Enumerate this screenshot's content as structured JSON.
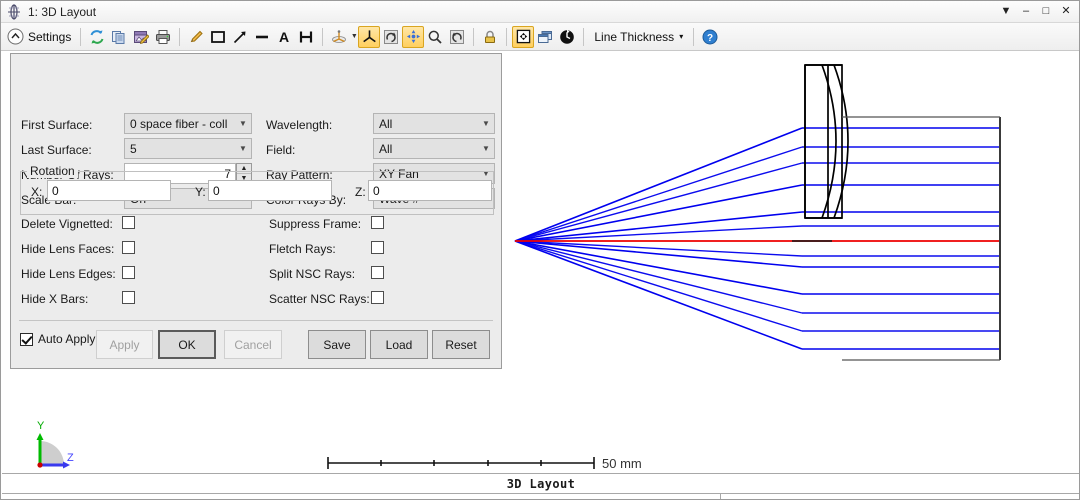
{
  "window": {
    "title": "1: 3D Layout",
    "icon": "layout-3d-icon",
    "controls": {
      "dropdown": "▼",
      "minimize": "–",
      "maximize": "□",
      "close": "✕"
    }
  },
  "toolbar": {
    "settings_label": "Settings",
    "line_thickness_label": "Line Thickness",
    "line_thickness_caret": "▾",
    "icons": [
      "refresh-icon",
      "copy-icon",
      "save-image-icon",
      "print-icon",
      "pencil-icon",
      "rectangle-icon",
      "arrow-icon",
      "line-icon",
      "text-icon",
      "measure-icon",
      "orientation-icon",
      "orientation-caret-icon",
      "isometric-view-icon",
      "rotate-icon",
      "pan-icon",
      "zoom-icon",
      "undo-zoom-icon",
      "lock-icon",
      "fit-window-icon",
      "window-clone-icon",
      "refresh-clock-icon",
      "help-icon"
    ]
  },
  "settings": {
    "left_column": [
      {
        "label": "First Surface:",
        "value": "0 space fiber - coll",
        "type": "combo"
      },
      {
        "label": "Last Surface:",
        "value": "5",
        "type": "combo"
      },
      {
        "label": "Number Of Rays:",
        "value": "7",
        "type": "spinner"
      },
      {
        "label": "Scale Bar:",
        "value": "On",
        "type": "combo"
      }
    ],
    "right_column": [
      {
        "label": "Wavelength:",
        "value": "All",
        "type": "combo"
      },
      {
        "label": "Field:",
        "value": "All",
        "type": "combo"
      },
      {
        "label": "Ray Pattern:",
        "value": "XY Fan",
        "type": "combo"
      },
      {
        "label": "Color Rays By:",
        "value": "Wave #",
        "type": "combo"
      }
    ],
    "rotation": {
      "group_title": "Rotation",
      "x_label": "X:",
      "x_value": "0",
      "y_label": "Y:",
      "y_value": "0",
      "z_label": "Z:",
      "z_value": "0"
    },
    "checkboxes_left": [
      {
        "label": "Delete Vignetted:",
        "checked": false
      },
      {
        "label": "Hide Lens Faces:",
        "checked": false
      },
      {
        "label": "Hide Lens Edges:",
        "checked": false
      },
      {
        "label": "Hide X Bars:",
        "checked": false
      }
    ],
    "checkboxes_right": [
      {
        "label": "Suppress Frame:",
        "checked": false
      },
      {
        "label": "Fletch Rays:",
        "checked": false
      },
      {
        "label": "Split NSC Rays:",
        "checked": false
      },
      {
        "label": "Scatter NSC Rays:",
        "checked": false
      }
    ],
    "auto_apply_label": "Auto Apply",
    "auto_apply_checked": true,
    "buttons": {
      "apply": "Apply",
      "ok": "OK",
      "cancel": "Cancel",
      "save": "Save",
      "load": "Load",
      "reset": "Reset"
    }
  },
  "graphics": {
    "scale_bar_label": "50 mm",
    "axis_y_label": "Y",
    "axis_z_label": "Z",
    "caption": "3D  Layout",
    "colors": {
      "ray_blue": "#0000ee",
      "ray_red": "#ee0000",
      "element_outline": "#000000",
      "axis_y": "#00aa00",
      "axis_z": "#4444ff",
      "accent_gold": "#ffcf5e"
    }
  }
}
